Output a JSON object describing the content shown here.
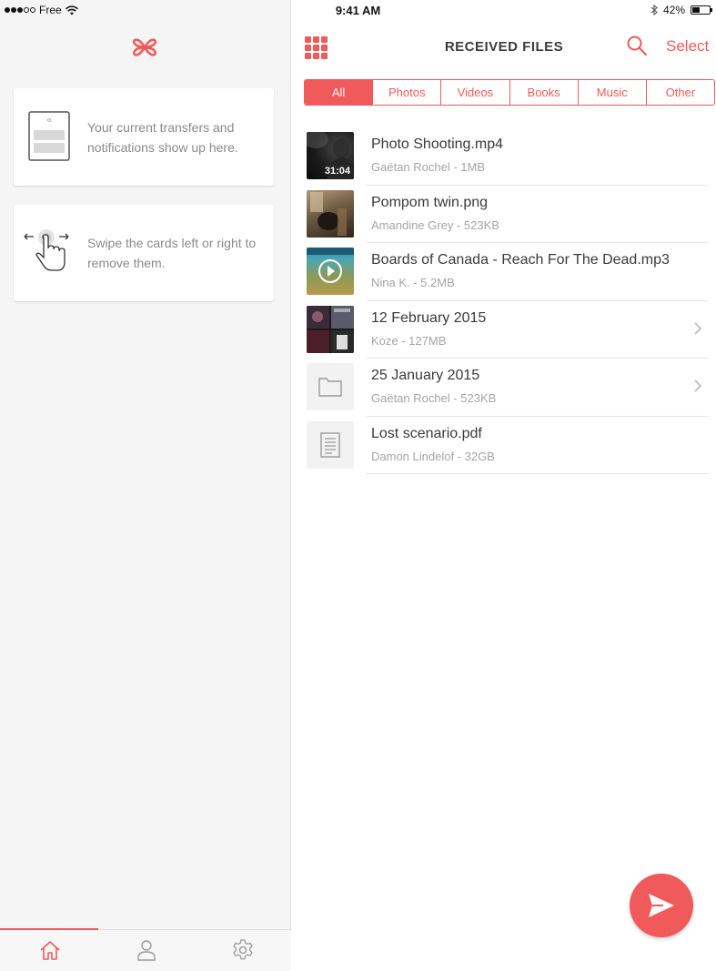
{
  "status_bar": {
    "carrier": "Free",
    "time": "9:41 AM",
    "battery": "42%",
    "battery_level": 0.42
  },
  "sidebar": {
    "cards": [
      {
        "text": "Your current transfers and notifications show up here."
      },
      {
        "text": "Swipe the cards left or right to remove them."
      }
    ],
    "tabs": [
      {
        "icon": "home-icon",
        "active": true
      },
      {
        "icon": "user-icon",
        "active": false
      },
      {
        "icon": "gear-icon",
        "active": false
      }
    ]
  },
  "header": {
    "title": "RECEIVED FILES",
    "select_label": "Select"
  },
  "filters": [
    "All",
    "Photos",
    "Videos",
    "Books",
    "Music",
    "Other"
  ],
  "files": [
    {
      "name": "Photo Shooting.mp4",
      "meta": "Gaëtan Rochel - 1MB",
      "duration": "31:04",
      "thumb": "video"
    },
    {
      "name": "Pompom twin.png",
      "meta": "Amandine Grey - 523KB",
      "thumb": "photo"
    },
    {
      "name": "Boards of Canada - Reach For The Dead.mp3",
      "meta": "Nina K. - 5.2MB",
      "thumb": "audio"
    },
    {
      "name": "12 February 2015",
      "meta": "Koze - 127MB",
      "thumb": "collage"
    },
    {
      "name": "25 January 2015",
      "meta": "Gaëtan Rochel - 523KB",
      "thumb": "folder"
    },
    {
      "name": "Lost scenario.pdf",
      "meta": "Damon Lindelof - 32GB",
      "thumb": "document"
    }
  ],
  "colors": {
    "accent": "#f05a5a",
    "sidebar_bg": "#f5f5f5",
    "muted_text": "#a5a5a5"
  }
}
